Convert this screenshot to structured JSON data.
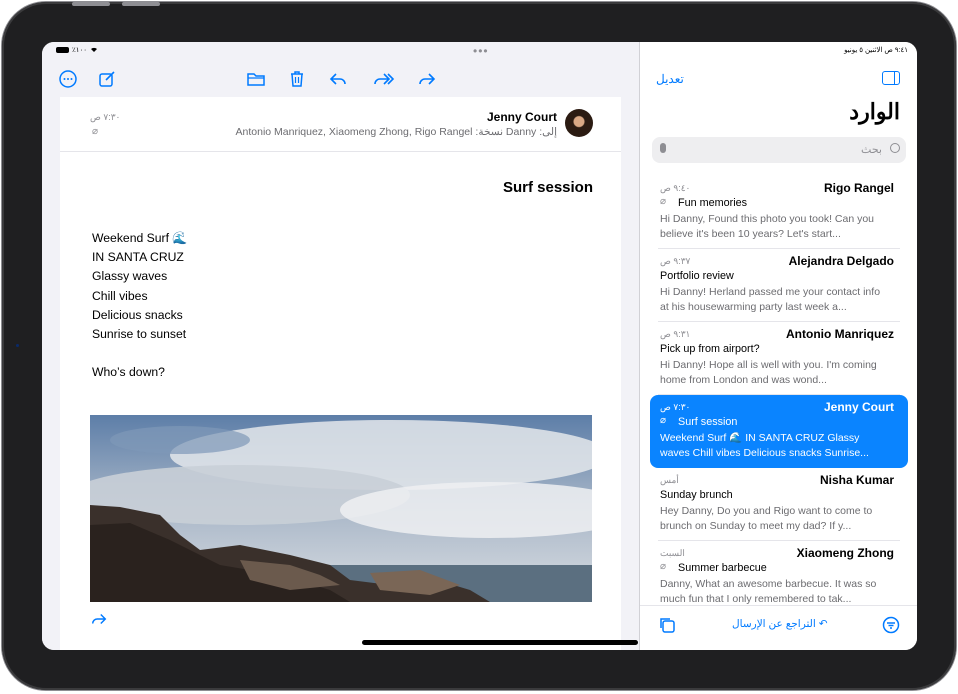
{
  "status": {
    "left_text": "٪١٠٠",
    "right_text": "٩:٤١ ص  الاثنين ٥ يونيو"
  },
  "colors": {
    "accent": "#007aff",
    "selected": "#0a84ff"
  },
  "detail": {
    "toolbar": {
      "more": "ellipsis-circle-icon",
      "compose": "compose-icon",
      "folder": "folder-icon",
      "trash": "trash-icon",
      "reply": "reply-icon",
      "reply_all": "reply-all-icon",
      "forward": "forward-icon"
    },
    "sender": "Jenny Court",
    "recipients": "Antonio Manriquez, Xiaomeng Zhong, Rigo Rangel  :نسخة    Danny  :إلى",
    "time": "٧:٣٠ ص",
    "subject": "Surf session",
    "body_lines": [
      "Weekend Surf 🌊",
      "IN SANTA CRUZ",
      "Glassy waves",
      "Chill vibes",
      "Delicious snacks",
      "Sunrise to sunset"
    ],
    "closing": "Who’s down?"
  },
  "list": {
    "edit": "تعديل",
    "title": "الوارد",
    "search_placeholder": "بحث",
    "undo_send": "التراجع عن الإرسال",
    "messages": [
      {
        "name": "Rigo Rangel",
        "time": "٩:٤٠ ص",
        "subject": "Fun memories",
        "preview": "Hi Danny, Found this photo you took! Can you believe it's been 10 years? Let's start...",
        "attachment": true
      },
      {
        "name": "Alejandra Delgado",
        "time": "٩:٣٧ ص",
        "subject": "Portfolio review",
        "preview": "Hi Danny! Herland passed me your contact info at his housewarming party last week a...",
        "attachment": false
      },
      {
        "name": "Antonio Manriquez",
        "time": "٩:٣١ ص",
        "subject": "Pick up from airport?",
        "preview": "Hi Danny! Hope all is well with you. I'm coming home from London and was wond...",
        "attachment": false
      },
      {
        "name": "Jenny Court",
        "time": "٧:٣٠ ص",
        "subject": "Surf session",
        "preview": "Weekend Surf 🌊 IN SANTA CRUZ Glassy waves Chill vibes Delicious snacks Sunrise...",
        "attachment": true,
        "selected": true
      },
      {
        "name": "Nisha Kumar",
        "time": "أمس",
        "subject": "Sunday brunch",
        "preview": "Hey Danny, Do you and Rigo want to come to brunch on Sunday to meet my dad? If y...",
        "attachment": false
      },
      {
        "name": "Xiaomeng Zhong",
        "time": "السبت",
        "subject": "Summer barbecue",
        "preview": "Danny, What an awesome barbecue. It was so much fun that I only remembered to tak...",
        "attachment": true
      }
    ]
  }
}
